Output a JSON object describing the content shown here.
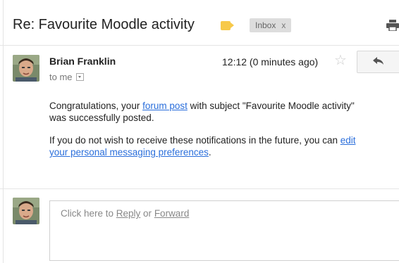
{
  "header": {
    "subject": "Re: Favourite Moodle activity",
    "label_badge": "Inbox",
    "label_remove": "x"
  },
  "message": {
    "sender": "Brian Franklin",
    "to": "to me",
    "time": "12:12 (0 minutes ago)",
    "star": "☆",
    "body": {
      "p1_before": "Congratulations, your ",
      "p1_link": "forum post",
      "p1_after": " with subject \"Favourite Moodle activity\"",
      "p1_line2": "was successfully posted.",
      "p2_before": "If you do not wish to receive these notifications in the future, you can ",
      "p2_link1": "edit",
      "p2_link2": "your personal messaging preferences",
      "p2_end": "."
    }
  },
  "reply": {
    "prefix": "Click here to ",
    "reply_link": "Reply",
    "or": " or ",
    "forward_link": "Forward"
  },
  "icons": {
    "label": "label-tag-icon",
    "print": "print-icon",
    "star": "star-icon",
    "reply": "reply-arrow-icon",
    "dropdown": "chevron-down-icon"
  },
  "colors": {
    "link": "#2a6edb",
    "label_tag": "#f7c94a",
    "badge_bg": "#dddddd"
  }
}
